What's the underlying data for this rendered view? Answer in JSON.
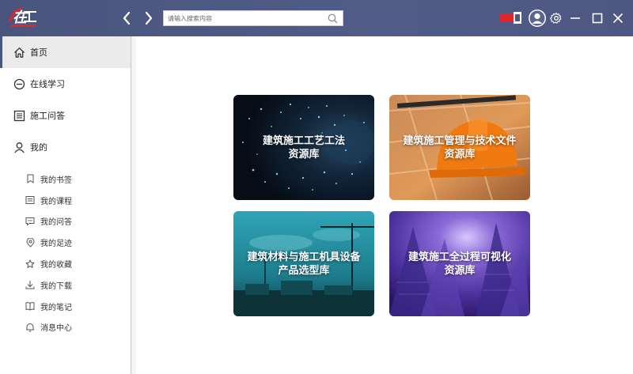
{
  "header": {
    "logo_icon": "app-logo",
    "back_icon": "chevron-left-icon",
    "forward_icon": "chevron-right-icon",
    "search": {
      "placeholder": "请输入搜索内容",
      "value": ""
    },
    "language_flag_icon": "flag-icon",
    "colors": {
      "bar": "#4d5781",
      "accent_red": "#e0262b"
    }
  },
  "sidebar": {
    "items": [
      {
        "label": "首页",
        "icon": "home-icon",
        "active": true
      },
      {
        "label": "在线学习",
        "icon": "minus-circle-icon",
        "active": false
      },
      {
        "label": "施工问答",
        "icon": "list-icon",
        "active": false
      },
      {
        "label": "我的",
        "icon": "user-icon",
        "active": false
      }
    ],
    "sub_items": [
      {
        "label": "我的书签",
        "icon": "bookmark-icon"
      },
      {
        "label": "我的课程",
        "icon": "course-icon"
      },
      {
        "label": "我的问答",
        "icon": "chat-icon"
      },
      {
        "label": "我的足迹",
        "icon": "location-icon"
      },
      {
        "label": "我的收藏",
        "icon": "star-icon"
      },
      {
        "label": "我的下载",
        "icon": "download-icon"
      },
      {
        "label": "我的笔记",
        "icon": "notebook-icon"
      },
      {
        "label": "消息中心",
        "icon": "bell-icon"
      }
    ]
  },
  "cards": [
    {
      "title": "建筑施工工艺工法\n资源库"
    },
    {
      "title": "建筑施工管理与技术文件\n资源库"
    },
    {
      "title": "建筑材料与施工机具设备\n产品选型库"
    },
    {
      "title": "建筑施工全过程可视化\n资源库"
    }
  ]
}
